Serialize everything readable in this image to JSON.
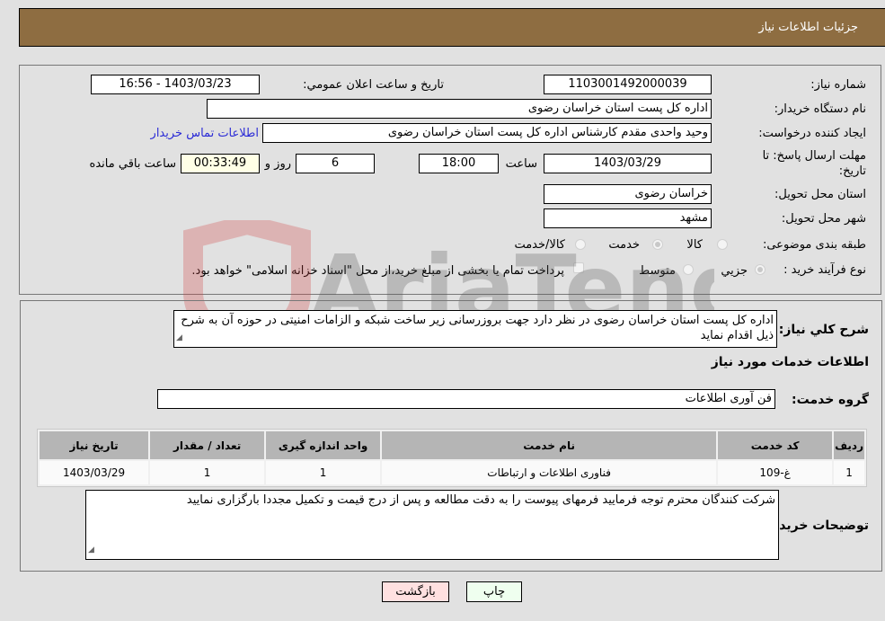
{
  "header": {
    "title": "جزئيات اطلاعات نیاز"
  },
  "details": {
    "need_number_label": "شماره نیاز:",
    "need_number": "1103001492000039",
    "announce_label": "تاريخ و ساعت اعلان عمومي:",
    "announce_value": "1403/03/23 - 16:56",
    "buyer_org_label": "نام دستگاه خریدار:",
    "buyer_org": "اداره کل پست استان خراسان رضوی",
    "requester_label": "ایجاد کننده درخواست:",
    "requester": "وحید واحدی مقدم کارشناس اداره کل پست استان خراسان رضوی",
    "contact_link": "اطلاعات تماس خریدار",
    "deadline_label": "مهلت ارسال پاسخ: تا تاریخ:",
    "deadline_date": "1403/03/29",
    "time_label": "ساعت",
    "deadline_time": "18:00",
    "days_value": "6",
    "days_label": "روز و",
    "remaining_time": "00:33:49",
    "remaining_label": "ساعت باقي مانده",
    "province_label": "استان محل تحویل:",
    "province": "خراسان رضوی",
    "city_label": "شهر محل تحویل:",
    "city": "مشهد",
    "category_label": "طبقه بندی موضوعی:",
    "category_options": [
      {
        "label": "کالا",
        "checked": false
      },
      {
        "label": "خدمت",
        "checked": true
      },
      {
        "label": "کالا/خدمت",
        "checked": false
      }
    ],
    "purchase_type_label": "نوع فرآیند خرید :",
    "purchase_options": [
      {
        "label": "جزيي",
        "checked": true
      },
      {
        "label": "متوسط",
        "checked": false
      }
    ],
    "treasury_note": "پرداخت تمام یا بخشی از مبلغ خرید،از محل \"اسناد خزانه اسلامی\" خواهد بود."
  },
  "description": {
    "label": "شرح کلي نياز:",
    "text": "اداره کل پست استان خراسان رضوی در نظر دارد جهت بروزرسانی زیر ساخت شبکه و الزامات امنیتی در حوزه آن به شرح ذیل اقدام نماید"
  },
  "services": {
    "section_title": "اطلاعات خدمات مورد نياز",
    "group_label": "گروه خدمت:",
    "group_value": "فن آوری اطلاعات",
    "columns": [
      "ردیف",
      "کد خدمت",
      "نام خدمت",
      "واحد اندازه گیری",
      "تعداد / مقدار",
      "تاریخ نیاز"
    ],
    "rows": [
      [
        "1",
        "غ-109",
        "فناوری اطلاعات و ارتباطات",
        "1",
        "1",
        "1403/03/29"
      ]
    ]
  },
  "buyer_notes": {
    "label": "توضیحات خریدار:",
    "text": "شرکت کنندگان محترم توجه فرمایید فرمهای پیوست را به دقت مطالعه و پس از درج قیمت و تکمیل  مجددا بارگزاری نمایید"
  },
  "buttons": {
    "print": "چاپ",
    "back": "بازگشت"
  },
  "watermark": {
    "text": "AriaTender.neT"
  }
}
